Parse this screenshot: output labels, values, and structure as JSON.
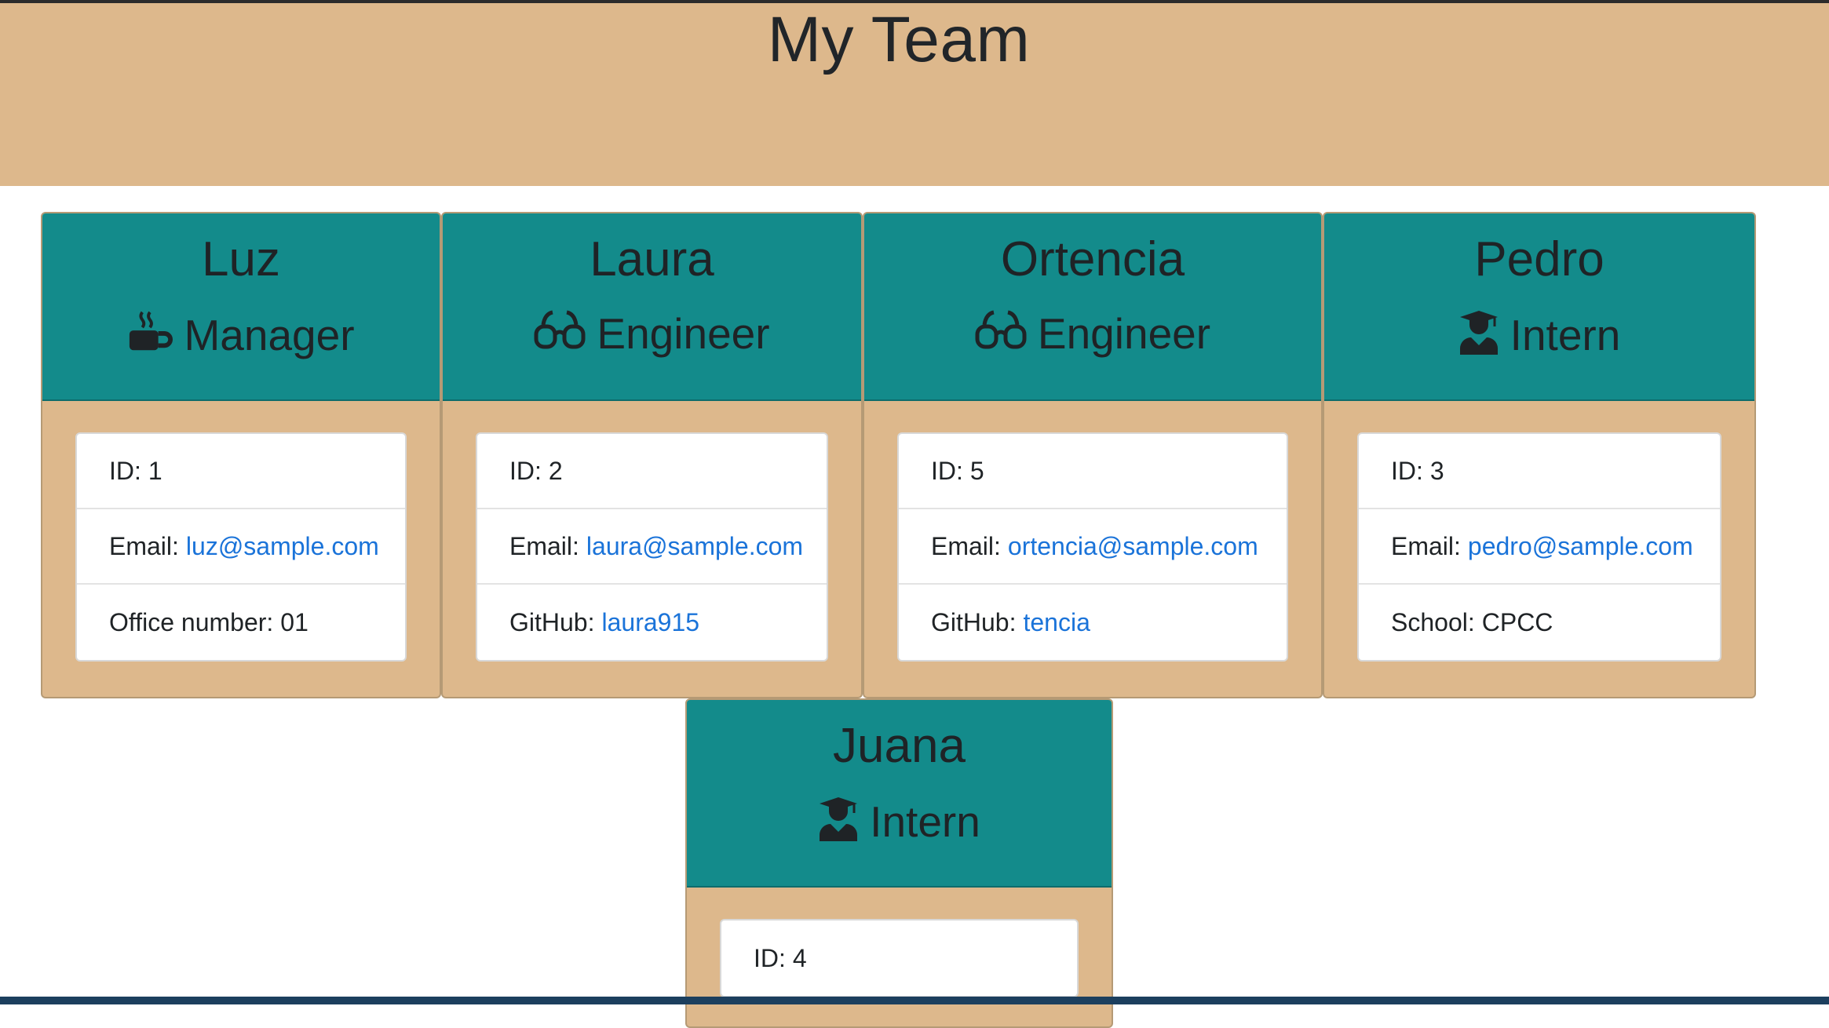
{
  "page": {
    "title": "My Team"
  },
  "colors": {
    "header_band": "#ddb88c",
    "card_header": "#138b8b",
    "link": "#1a73d9"
  },
  "employees": [
    {
      "name": "Luz",
      "role": "Manager",
      "role_icon": "mug-hot-icon",
      "id_label": "ID:",
      "id": "1",
      "email_label": "Email:",
      "email": "luz@sample.com",
      "extra_label": "Office number:",
      "extra_value": "01"
    },
    {
      "name": "Laura",
      "role": "Engineer",
      "role_icon": "glasses-icon",
      "id_label": "ID:",
      "id": "2",
      "email_label": "Email:",
      "email": "laura@sample.com",
      "extra_label": "GitHub:",
      "extra_value": "laura915"
    },
    {
      "name": "Ortencia",
      "role": "Engineer",
      "role_icon": "glasses-icon",
      "id_label": "ID:",
      "id": "5",
      "email_label": "Email:",
      "email": "ortencia@sample.com",
      "extra_label": "GitHub:",
      "extra_value": "tencia"
    },
    {
      "name": "Pedro",
      "role": "Intern",
      "role_icon": "user-graduate-icon",
      "id_label": "ID:",
      "id": "3",
      "email_label": "Email:",
      "email": "pedro@sample.com",
      "extra_label": "School:",
      "extra_value": "CPCC"
    },
    {
      "name": "Juana",
      "role": "Intern",
      "role_icon": "user-graduate-icon",
      "id_label": "ID:",
      "id": "4"
    }
  ]
}
